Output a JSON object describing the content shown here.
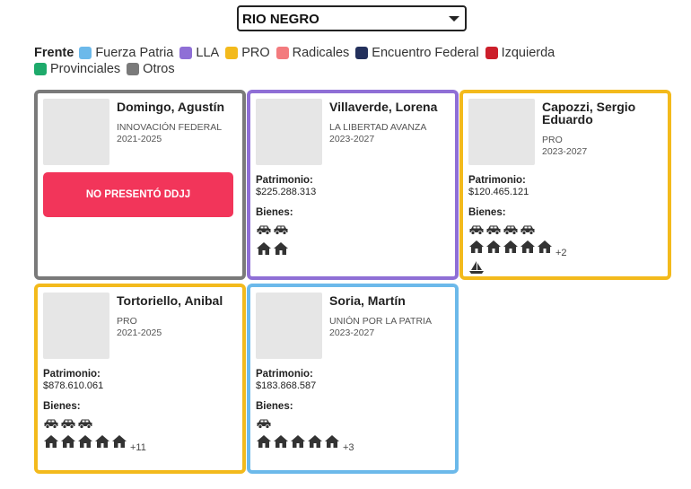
{
  "province_select": {
    "value": "RIO NEGRO"
  },
  "legend": {
    "title": "Frente",
    "items": [
      {
        "label": "Fuerza Patria",
        "color": "#6cb9ea"
      },
      {
        "label": "LLA",
        "color": "#8f6fd6"
      },
      {
        "label": "PRO",
        "color": "#f3ba1c"
      },
      {
        "label": "Radicales",
        "color": "#f37b7e"
      },
      {
        "label": "Encuentro Federal",
        "color": "#23305c"
      },
      {
        "label": "Izquierda",
        "color": "#cc1f2b"
      },
      {
        "label": "Provinciales",
        "color": "#1eaa6b"
      },
      {
        "label": "Otros",
        "color": "#7a7a7a"
      }
    ]
  },
  "labels": {
    "patrimonio": "Patrimonio:",
    "bienes": "Bienes:"
  },
  "cards": [
    {
      "name": "Domingo, Agustín",
      "party": "INNOVACIÓN FEDERAL",
      "period": "2021-2025",
      "border": "#7a7a7a",
      "no_ddjj": "NO PRESENTÓ DDJJ"
    },
    {
      "name": "Villaverde, Lorena",
      "party": "LA LIBERTAD AVANZA",
      "period": "2023-2027",
      "border": "#8f6fd6",
      "patrimonio": "$225.288.313",
      "cars": 2,
      "houses": 2,
      "houses_extra": "",
      "boats": 0
    },
    {
      "name": "Capozzi, Sergio Eduardo",
      "party": "PRO",
      "period": "2023-2027",
      "border": "#f3ba1c",
      "patrimonio": "$120.465.121",
      "cars": 4,
      "houses": 5,
      "houses_extra": "+2",
      "boats": 1
    },
    {
      "name": "Tortoriello, Anibal",
      "party": "PRO",
      "period": "2021-2025",
      "border": "#f3ba1c",
      "patrimonio": "$878.610.061",
      "cars": 3,
      "houses": 5,
      "houses_extra": "+11",
      "boats": 0
    },
    {
      "name": "Soria, Martín",
      "party": "UNIÓN POR LA PATRIA",
      "period": "2023-2027",
      "border": "#6cb9ea",
      "patrimonio": "$183.868.587",
      "cars": 1,
      "houses": 5,
      "houses_extra": "+3",
      "boats": 0
    }
  ]
}
